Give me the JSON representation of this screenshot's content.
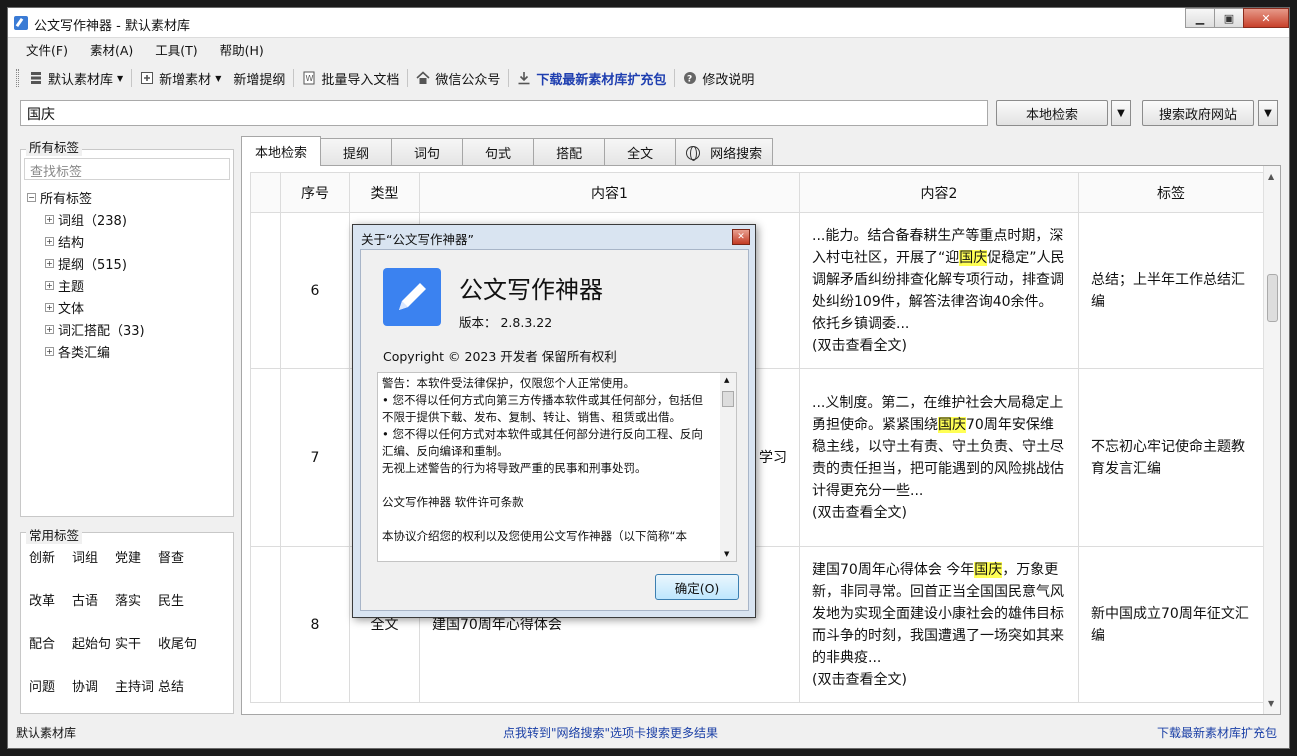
{
  "window": {
    "title": "公文写作神器 - 默认素材库"
  },
  "menu": [
    "文件(F)",
    "素材(A)",
    "工具(T)",
    "帮助(H)"
  ],
  "toolbar": {
    "library": "默认素材库",
    "add_material": "新增素材",
    "add_outline": "新增提纲",
    "batch_import": "批量导入文档",
    "wechat": "微信公众号",
    "download": "下载最新素材库扩充包",
    "changelog": "修改说明"
  },
  "search": {
    "value": "国庆",
    "local_btn": "本地检索",
    "gov_btn": "搜索政府网站"
  },
  "tags_panel": {
    "caption": "所有标签",
    "search_placeholder": "查找标签",
    "root": "所有标签",
    "items": [
      "词组（238)",
      "结构",
      "提纲（515)",
      "主题",
      "文体",
      "词汇搭配（33)",
      "各类汇编"
    ]
  },
  "common_tags": {
    "caption": "常用标签",
    "items": [
      "创新",
      "词组",
      "党建",
      "督查",
      "改革",
      "古语",
      "落实",
      "民生",
      "配合",
      "起始句",
      "实干",
      "收尾句",
      "问题",
      "协调",
      "主持词",
      "总结"
    ]
  },
  "tabs": [
    "本地检索",
    "提纲",
    "词句",
    "句式",
    "搭配",
    "全文",
    "网络搜索"
  ],
  "grid": {
    "headers": [
      "序号",
      "类型",
      "内容1",
      "内容2",
      "标签"
    ],
    "rows": [
      {
        "no": "6",
        "type": "",
        "content1": "",
        "content2_pre": "...能力。结合备春耕生产等重点时期，深入村屯社区，开展了“迎",
        "content2_hl": "国庆",
        "content2_post": "促稳定”人民调解矛盾纠纷排查化解专项行动，排查调处纠纷109件，解答法律咨询40余件。依托乡镇调委...",
        "content2_more": "(双击查看全文)",
        "tag": "总结；上半年工作总结汇编"
      },
      {
        "no": "7",
        "type": "",
        "content1": "”主 学习",
        "content2_pre": "...义制度。第二，在维护社会大局稳定上勇担使命。紧紧围绕",
        "content2_hl": "国庆",
        "content2_post": "70周年安保维稳主线，以守土有责、守土负责、守土尽责的责任担当，把可能遇到的风险挑战估计得更充分一些...",
        "content2_more": "(双击查看全文)",
        "tag": "不忘初心牢记使命主题教育发言汇编"
      },
      {
        "no": "8",
        "type": "全文",
        "content1": "建国70周年心得体会",
        "content2_pre": "建国70周年心得体会 今年",
        "content2_hl": "国庆",
        "content2_post": "，万象更新，非同寻常。回首正当全国国民意气风发地为实现全面建设小康社会的雄伟目标而斗争的时刻，我国遭遇了一场突如其来的非典疫...",
        "content2_more": "(双击查看全文)",
        "tag": "新中国成立70周年征文汇编"
      }
    ]
  },
  "status": {
    "left": "默认素材库",
    "center": "点我转到\"网络搜索\"选项卡搜索更多结果",
    "right": "下载最新素材库扩充包"
  },
  "dialog": {
    "title": "关于“公文写作神器”",
    "app_name": "公文写作神器",
    "version": "版本： 2.8.3.22",
    "copyright": "Copyright © 2023 开发者 保留所有权利",
    "license": [
      "警告：本软件受法律保护，仅限您个人正常使用。",
      "• 您不得以任何方式向第三方传播本软件或其任何部分，包括但不限于提供下载、发布、复制、转让、销售、租赁或出借。",
      "• 您不得以任何方式对本软件或其任何部分进行反向工程、反向汇编、反向编译和重制。",
      "无视上述警告的行为将导致严重的民事和刑事处罚。",
      "",
      "公文写作神器 软件许可条款",
      "",
      "本协议介绍您的权利以及您使用公文写作神器（以下简称“本"
    ],
    "ok": "确定(O)"
  }
}
